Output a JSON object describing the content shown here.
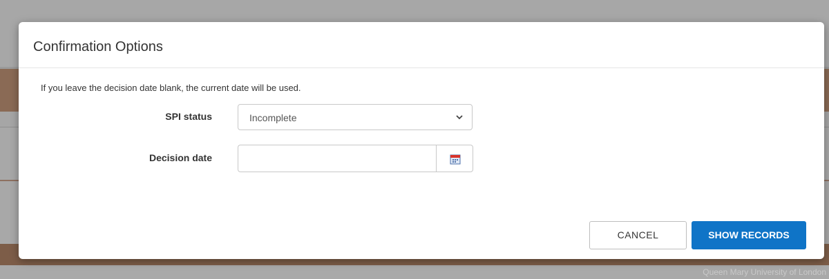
{
  "dialog": {
    "title": "Confirmation Options",
    "info_text": "If you leave the decision date blank, the current date will be used.",
    "fields": {
      "spi_status": {
        "label": "SPI status",
        "selected": "Incomplete",
        "icon": "chevron-down-icon"
      },
      "decision_date": {
        "label": "Decision date",
        "value": "",
        "placeholder": "",
        "icon": "calendar-icon"
      }
    },
    "buttons": {
      "cancel_label": "CANCEL",
      "show_records_label": "SHOW RECORDS"
    },
    "colors": {
      "primary": "#0f74c7",
      "backdrop": "#a8a8a8",
      "background_accent": "#8a6a55"
    }
  },
  "background": {
    "footer_text": "Queen Mary University of London"
  }
}
